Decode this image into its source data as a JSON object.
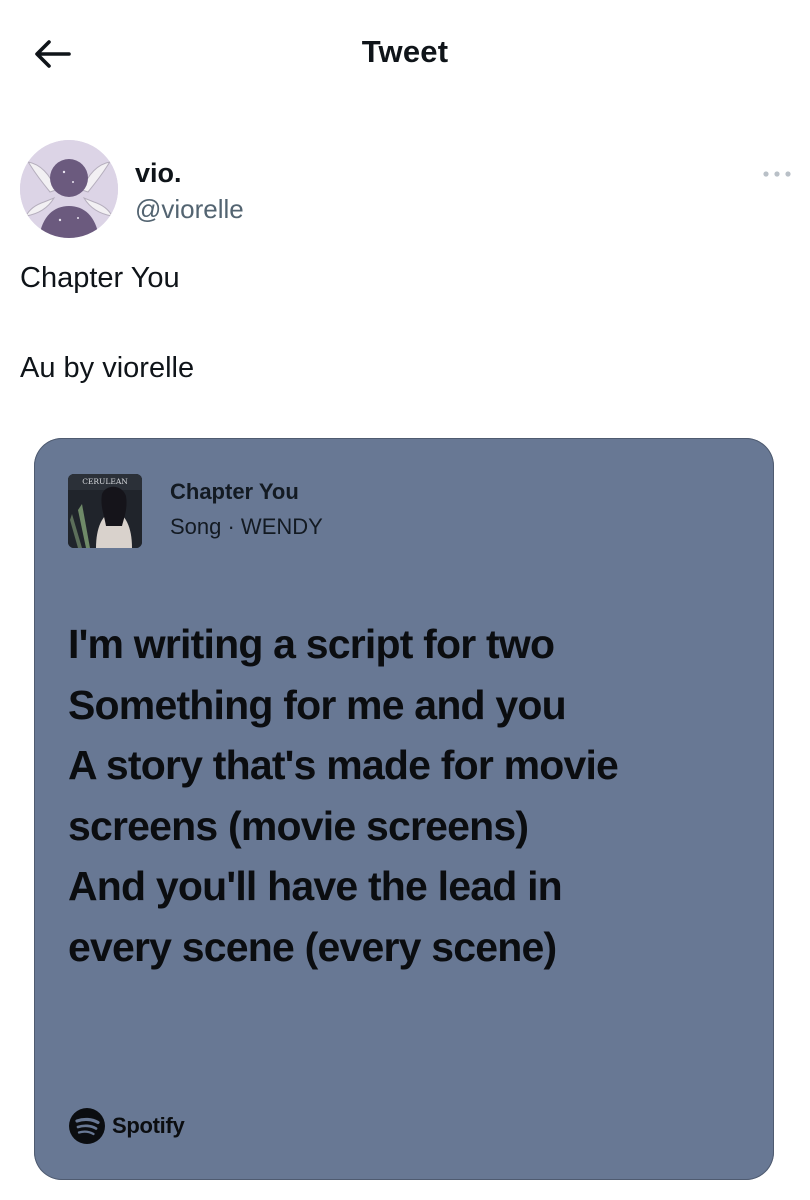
{
  "header": {
    "title": "Tweet",
    "back_icon": "arrow-left-icon"
  },
  "author": {
    "display_name": "vio.",
    "handle": "@viorelle",
    "avatar_icon": "fairy-avatar"
  },
  "tweet": {
    "text_lines": [
      "Chapter You",
      "Au by viorelle"
    ]
  },
  "lyrics_card": {
    "background_color": "#687894",
    "album_art_text": "CERULEAN",
    "song_title": "Chapter You",
    "song_meta": "Song · WENDY",
    "lyrics": [
      "I'm writing a script for two",
      "Something for me and you",
      "A story that's made for movie",
      "screens (movie screens)",
      "And you'll have the lead in",
      "every scene (every scene)"
    ],
    "brand": "Spotify"
  },
  "colors": {
    "text_primary": "#0f1419",
    "text_secondary": "#536471",
    "card": "#687894"
  }
}
